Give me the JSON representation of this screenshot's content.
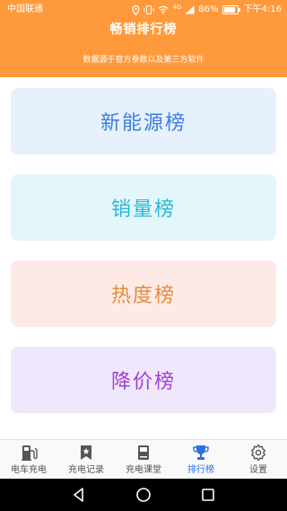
{
  "status_bar": {
    "carrier": "中国联通",
    "network": "4G",
    "battery": "86%",
    "battery_level": 0.86,
    "time": "下午4:16"
  },
  "header": {
    "title": "畅销排行榜",
    "subtitle": "数据源于官方参数以及第三方软件"
  },
  "cards": [
    {
      "label": "新能源榜",
      "bg": "#e7f0fd",
      "color": "#3a7fd8"
    },
    {
      "label": "销量榜",
      "bg": "#e3f7fb",
      "color": "#27b9d6"
    },
    {
      "label": "热度榜",
      "bg": "#fdeae6",
      "color": "#e48c3a"
    },
    {
      "label": "降价榜",
      "bg": "#efe8fd",
      "color": "#a23fd2"
    }
  ],
  "tabs": [
    {
      "label": "电车充电",
      "icon": "ev-charger-icon",
      "active": false
    },
    {
      "label": "充电记录",
      "icon": "bookmark-star-icon",
      "active": false
    },
    {
      "label": "充电课堂",
      "icon": "book-icon",
      "active": false
    },
    {
      "label": "排行榜",
      "icon": "trophy-icon",
      "active": true
    },
    {
      "label": "设置",
      "icon": "gear-icon",
      "active": false
    }
  ],
  "colors": {
    "header_bg": "#ff9a3c",
    "tab_active": "#2f6fe0",
    "tab_inactive": "#555555"
  }
}
